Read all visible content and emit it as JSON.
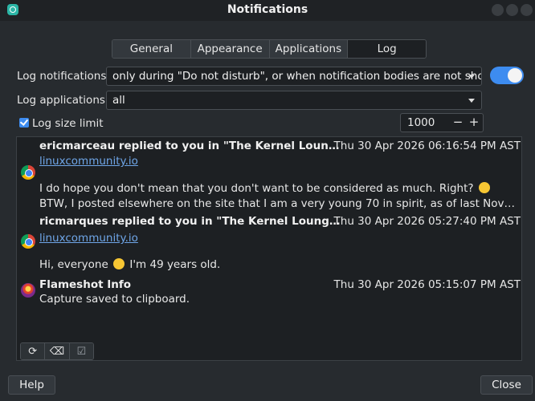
{
  "window": {
    "title": "Notifications"
  },
  "tabs": [
    {
      "label": "General",
      "active": false
    },
    {
      "label": "Appearance",
      "active": false
    },
    {
      "label": "Applications",
      "active": false
    },
    {
      "label": "Log",
      "active": true
    }
  ],
  "settings": {
    "log_notifications_label": "Log notifications",
    "log_notifications_value": "only during \"Do not disturb\", or when notification bodies are not shown",
    "log_notifications_enabled": true,
    "log_applications_label": "Log applications",
    "log_applications_value": "all",
    "log_size_limit_label": "Log size limit",
    "log_size_limit_checked": true,
    "log_size_limit_value": "1000",
    "minus_label": "−",
    "plus_label": "+"
  },
  "log": [
    {
      "icon": "chrome-icon",
      "title": "ericmarceau replied to you in \"The Kernel Lounge age t...",
      "time": "Thu 30 Apr 2026 06:16:54 PM AST",
      "link": "linuxcommunity.io",
      "body1_pre": "I do hope you don't mean that you don't want to be considered as much.  Right?",
      "body2": "BTW, I posted elsewhere on the site that I am a very young 70 in spirit, as of last November.  J..."
    },
    {
      "icon": "chrome-icon",
      "title": "ricmarques replied to you in \"The Kernel Lounge age th...",
      "time": "Thu 30 Apr 2026 05:27:40 PM AST",
      "link": "linuxcommunity.io",
      "body1_pre": "Hi, everyone",
      "body1_post": "I'm 49 years old."
    },
    {
      "icon": "flameshot-icon",
      "title": "Flameshot Info",
      "time": "Thu 30 Apr 2026 05:15:07 PM AST",
      "body1_pre": "Capture saved to clipboard."
    }
  ],
  "footer": {
    "help_label": "Help",
    "close_label": "Close"
  },
  "colors": {
    "accent": "#3d8cf0",
    "link": "#6fa6e8",
    "background": "#272b2f"
  }
}
